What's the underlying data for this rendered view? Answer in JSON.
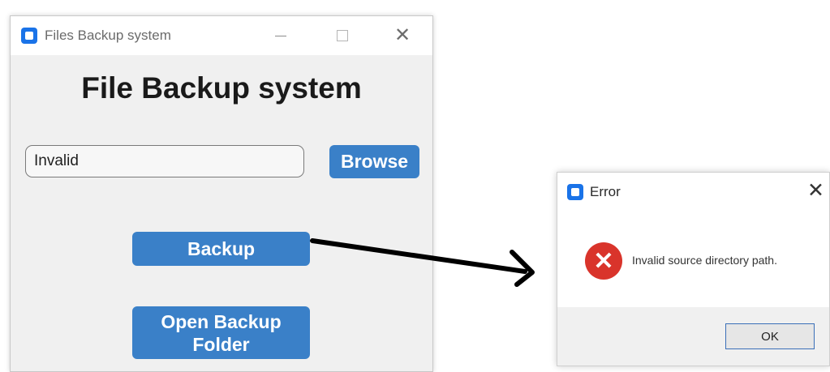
{
  "main_window": {
    "title": "Files Backup system",
    "heading": "File Backup system",
    "path_input": {
      "value": "Invalid"
    },
    "browse_label": "Browse",
    "backup_label": "Backup",
    "open_backup_folder_label": "Open Backup\nFolder",
    "controls": {
      "minimize": "minimize-icon",
      "maximize": "maximize-icon",
      "close": "close-icon"
    }
  },
  "error_dialog": {
    "title": "Error",
    "message": "Invalid source directory path.",
    "ok_label": "OK",
    "icon": "error-x-icon"
  },
  "colors": {
    "button_blue": "#3a80c8",
    "error_red": "#d9342b",
    "app_icon_blue": "#1a73e8"
  }
}
